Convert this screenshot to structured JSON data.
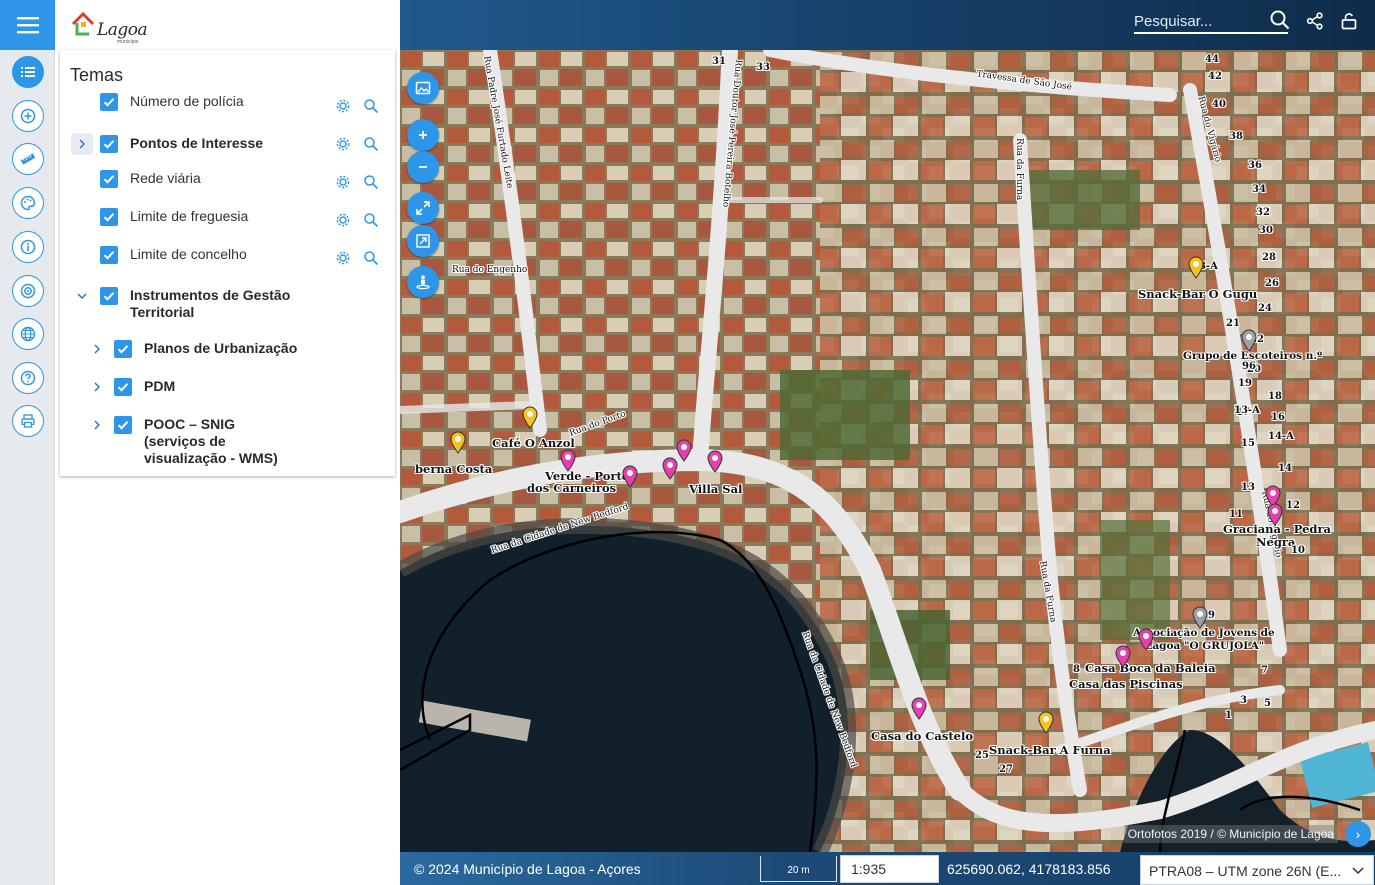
{
  "header": {
    "logo_text": "Lagoa",
    "logo_subtext": "município",
    "search_placeholder": "Pesquisar...",
    "icons": [
      "menu-icon",
      "search-icon",
      "share-icon",
      "lock-icon"
    ]
  },
  "rail": {
    "buttons": [
      "layers-list-icon",
      "add-layer-icon",
      "measure-ruler-icon",
      "palette-icon",
      "info-icon",
      "target-icon",
      "globe-icon",
      "help-icon",
      "print-icon"
    ]
  },
  "panel": {
    "title": "Temas",
    "layers": [
      {
        "label": "Número de polícia",
        "checked": true,
        "expandable": false
      },
      {
        "label": "Pontos de Interesse",
        "checked": true,
        "expandable": true
      },
      {
        "label": "Rede viária",
        "checked": true,
        "expandable": false
      },
      {
        "label": "Limite de freguesia",
        "checked": true,
        "expandable": false
      },
      {
        "label": "Limite de concelho",
        "checked": true,
        "expandable": false
      },
      {
        "label": "Instrumentos de Gestão Territorial",
        "checked": true,
        "expanded": true
      },
      {
        "label": "Planos de Urbanização",
        "checked": true,
        "expandable": true
      },
      {
        "label": "PDM",
        "checked": true,
        "expandable": true
      },
      {
        "label": "POOC – SNIG (serviços de visualização - WMS)",
        "checked": true,
        "expandable": true
      }
    ]
  },
  "map": {
    "controls": [
      "basemap-icon",
      "zoom-in-icon",
      "zoom-out-icon",
      "fullscreen-icon",
      "zoom-extent-icon",
      "street-view-icon"
    ],
    "street_labels": [
      "Rua da Cidade de New Bedford",
      "Rua da Cidade de New Bedford",
      "Travessa de São José",
      "Rua do Engenho",
      "Rua da Furna",
      "Rua da Furna",
      "Rua do Vigário",
      "Rua do Vigário",
      "Rua Doutor José Pereira Botelho",
      "Rua Padre José Furtado Leite",
      "Rua do Porto"
    ],
    "poi_labels": [
      "Snack-Bar O Gugu",
      "Grupo de Escoteiros n.º",
      "Café O Anzol",
      "berna Costa",
      "Verde - Porto",
      "dos Carneiros",
      "Villa Sal",
      "Graciana - Pedra",
      "Negra",
      "Associação de Jovens de",
      "Lagoa \"O GRUJOLA\"",
      "Casa Boca da Baleia",
      "Casa das Piscinas",
      "Casa do Castelo",
      "Snack-Bar A Furna"
    ],
    "house_numbers": [
      "31",
      "33",
      "32",
      "44",
      "42",
      "40",
      "38",
      "36",
      "34",
      "32",
      "30",
      "28",
      "26",
      "24",
      "23-A",
      "22",
      "20",
      "18",
      "16",
      "14-A",
      "14",
      "12",
      "10",
      "21",
      "19",
      "17",
      "15",
      "13",
      "11",
      "9",
      "7",
      "5",
      "3",
      "1",
      "27",
      "29",
      "25",
      "96",
      "13-A",
      "8"
    ],
    "attribution": "Ortofotos 2019 / © Município de Lagoa",
    "attribution_button": "›"
  },
  "footer": {
    "copyright": "© 2024 Município de Lagoa - Açores",
    "scale_bar_label": "20 m",
    "scale_value": "1:935",
    "coordinates": "625690.062, 4178183.856",
    "crs_selected": "PTRA08 – UTM zone 26N (E..."
  },
  "colors": {
    "accent": "#2e96e8",
    "poi_pink": "#e63fb0",
    "poi_yellow": "#f6c21c",
    "poi_grey": "#9aa0a6"
  }
}
